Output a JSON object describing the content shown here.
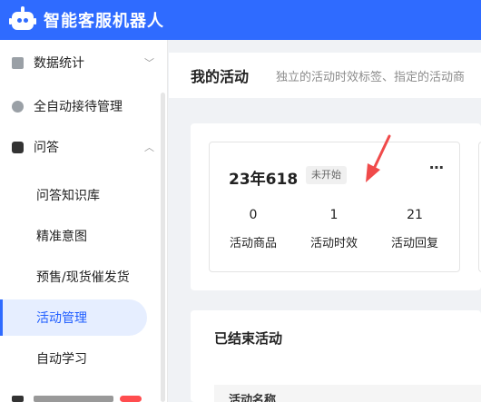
{
  "app": {
    "title": "智能客服机器人"
  },
  "sidebar": {
    "items": [
      {
        "label": "数据统计",
        "icon": "bar-chart-icon",
        "expandable": true,
        "expanded": false
      },
      {
        "label": "全自动接待管理",
        "icon": "robot-icon",
        "expandable": false
      },
      {
        "label": "问答",
        "icon": "chat-icon",
        "expandable": true,
        "expanded": true,
        "children": [
          {
            "label": "问答知识库"
          },
          {
            "label": "精准意图"
          },
          {
            "label": "预售/现货催发货"
          },
          {
            "label": "活动管理",
            "active": true
          },
          {
            "label": "自动学习"
          }
        ]
      }
    ]
  },
  "page": {
    "title": "我的活动",
    "description": "独立的活动时效标签、指定的活动商"
  },
  "activity": {
    "name": "23年618",
    "status": "未开始",
    "more_icon": "⋯",
    "stats": [
      {
        "value": "0",
        "label": "活动商品"
      },
      {
        "value": "1",
        "label": "活动时效"
      },
      {
        "value": "21",
        "label": "活动回复"
      }
    ]
  },
  "ended": {
    "title": "已结束活动",
    "table_columns": [
      "活动名称"
    ]
  },
  "colors": {
    "brand": "#2f6bff",
    "active_bg": "#e6eeff",
    "arrow": "#f04a4a"
  }
}
